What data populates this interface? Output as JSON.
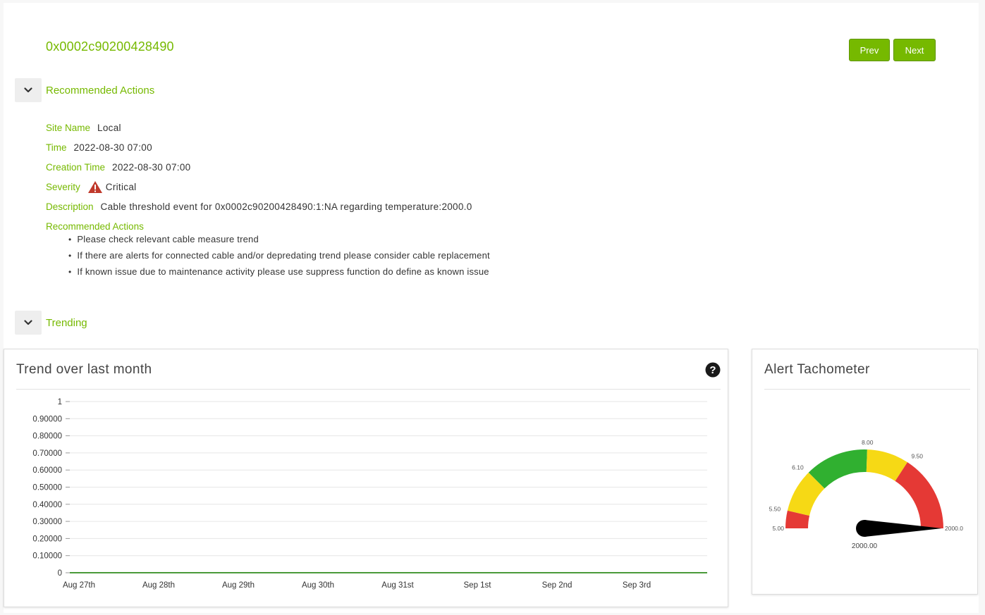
{
  "header": {
    "device_guid": "0x0002c90200428490",
    "prev_label": "Prev",
    "next_label": "Next"
  },
  "recommended_section": {
    "title": "Recommended Actions",
    "fields": [
      {
        "label": "Site Name",
        "value": "Local"
      },
      {
        "label": "Time",
        "value": "2022-08-30 07:00"
      },
      {
        "label": "Creation Time",
        "value": "2022-08-30 07:00"
      },
      {
        "label": "Severity",
        "value": "Critical",
        "icon": "warning-triangle-icon",
        "color": "#c0392b"
      },
      {
        "label": "Description",
        "value": "Cable threshold event for 0x0002c90200428490:1:NA regarding temperature:2000.0"
      }
    ],
    "actions_label": "Recommended Actions",
    "actions": [
      "Please check relevant cable measure trend",
      "If there are alerts for connected cable and/or depredating trend please consider cable replacement",
      "If known issue due to maintenance activity please use suppress function do define as known issue"
    ]
  },
  "trending_section": {
    "title": "Trending"
  },
  "trend_panel": {
    "title": "Trend over last month",
    "help_icon": "question-circle-icon"
  },
  "tach_panel": {
    "title": "Alert Tachometer"
  },
  "chart_data": [
    {
      "type": "line",
      "title": "Trend over last month",
      "categories": [
        "Aug 27th",
        "Aug 28th",
        "Aug 29th",
        "Aug 30th",
        "Aug 31st",
        "Sep 1st",
        "Sep 2nd",
        "Sep 3rd"
      ],
      "series": [
        {
          "values": [
            0,
            0,
            0,
            0,
            0,
            0,
            0,
            0
          ],
          "color": "#4a9a3a"
        }
      ],
      "y_ticks": [
        "0",
        "0.10000",
        "0.20000",
        "0.30000",
        "0.40000",
        "0.50000",
        "0.60000",
        "0.70000",
        "0.80000",
        "0.90000",
        "1"
      ],
      "ylim": [
        0,
        1
      ],
      "grid": true,
      "xlabel": "",
      "ylabel": ""
    },
    {
      "type": "gauge",
      "title": "Alert Tachometer",
      "value": 2000.0,
      "value_label": "2000.00",
      "ticks": [
        "5.00",
        "5.50",
        "6.10",
        "8.00",
        "9.50",
        "2000.0"
      ],
      "bands": [
        {
          "color": "#e53935"
        },
        {
          "color": "#f6d915"
        },
        {
          "color": "#30b030"
        },
        {
          "color": "#f6d915"
        },
        {
          "color": "#e53935"
        }
      ],
      "needle_color": "#000000"
    }
  ]
}
